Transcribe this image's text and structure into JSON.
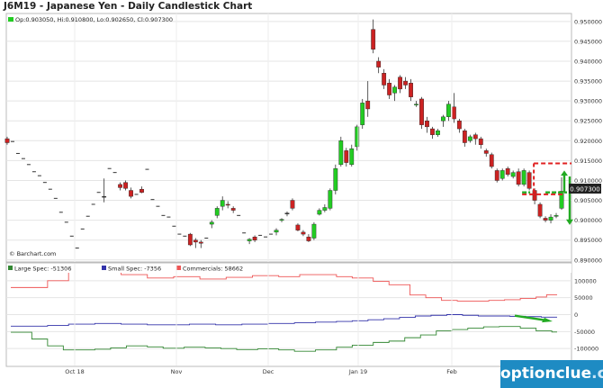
{
  "title": "J6M19 - Japanese Yen - Daily Candlestick Chart",
  "ohlc_legend": "Op:0.903050, Hi:0.910800, Lo:0.902650, Cl:0.907300",
  "credit": "© Barchart.com",
  "last_price_label": "0.907300",
  "brand": {
    "name": "optionclue",
    "suffix": ".com"
  },
  "colors": {
    "up": "#22cc22",
    "down": "#cc2222",
    "flat": "#333333",
    "large_spec": "#338833",
    "small_spec": "#3333aa",
    "commercials": "#ee5555",
    "annotation": "#e02020",
    "arrow": "#22aa22",
    "brand_bg": "#1e8bc3"
  },
  "chart_data": [
    {
      "type": "candlestick",
      "title": "J6M19 - Japanese Yen - Daily Candlestick Chart",
      "x_ticks": [
        "Oct 18",
        "Nov",
        "Dec",
        "Jan 19",
        "Feb"
      ],
      "y_ticks": [
        "0.890000",
        "0.895000",
        "0.900000",
        "0.905000",
        "0.910000",
        "0.915000",
        "0.920000",
        "0.925000",
        "0.930000",
        "0.935000",
        "0.940000",
        "0.945000",
        "0.950000"
      ],
      "ylim": [
        0.8895,
        0.952
      ],
      "grid": true,
      "candles": [
        {
          "o": 0.9205,
          "h": 0.921,
          "l": 0.919,
          "c": 0.9195
        },
        {
          "o": 0.9198,
          "h": 0.9198,
          "l": 0.9198,
          "c": 0.9198
        },
        {
          "o": 0.9168,
          "h": 0.9168,
          "l": 0.9168,
          "c": 0.9168
        },
        {
          "o": 0.9155,
          "h": 0.9155,
          "l": 0.9155,
          "c": 0.9155
        },
        {
          "o": 0.914,
          "h": 0.914,
          "l": 0.914,
          "c": 0.914
        },
        {
          "o": 0.9122,
          "h": 0.9122,
          "l": 0.9122,
          "c": 0.9122
        },
        {
          "o": 0.9112,
          "h": 0.9112,
          "l": 0.9112,
          "c": 0.9112
        },
        {
          "o": 0.9095,
          "h": 0.9095,
          "l": 0.9095,
          "c": 0.9095
        },
        {
          "o": 0.9078,
          "h": 0.9078,
          "l": 0.9078,
          "c": 0.9078
        },
        {
          "o": 0.9055,
          "h": 0.9055,
          "l": 0.9055,
          "c": 0.9055
        },
        {
          "o": 0.902,
          "h": 0.902,
          "l": 0.902,
          "c": 0.902
        },
        {
          "o": 0.8995,
          "h": 0.8995,
          "l": 0.8995,
          "c": 0.8995
        },
        {
          "o": 0.896,
          "h": 0.896,
          "l": 0.896,
          "c": 0.896
        },
        {
          "o": 0.893,
          "h": 0.893,
          "l": 0.893,
          "c": 0.893
        },
        {
          "o": 0.8978,
          "h": 0.8978,
          "l": 0.8978,
          "c": 0.8978
        },
        {
          "o": 0.901,
          "h": 0.901,
          "l": 0.901,
          "c": 0.901
        },
        {
          "o": 0.904,
          "h": 0.904,
          "l": 0.904,
          "c": 0.904
        },
        {
          "o": 0.907,
          "h": 0.907,
          "l": 0.907,
          "c": 0.907
        },
        {
          "o": 0.906,
          "h": 0.9105,
          "l": 0.9045,
          "c": 0.906
        },
        {
          "o": 0.913,
          "h": 0.913,
          "l": 0.913,
          "c": 0.913
        },
        {
          "o": 0.912,
          "h": 0.912,
          "l": 0.912,
          "c": 0.912
        },
        {
          "o": 0.909,
          "h": 0.9095,
          "l": 0.9075,
          "c": 0.9082
        },
        {
          "o": 0.9095,
          "h": 0.91,
          "l": 0.9075,
          "c": 0.908
        },
        {
          "o": 0.9075,
          "h": 0.9082,
          "l": 0.9055,
          "c": 0.906
        },
        {
          "o": 0.9065,
          "h": 0.9065,
          "l": 0.9065,
          "c": 0.9065
        },
        {
          "o": 0.9078,
          "h": 0.9085,
          "l": 0.9068,
          "c": 0.907
        },
        {
          "o": 0.9128,
          "h": 0.9128,
          "l": 0.9128,
          "c": 0.9128
        },
        {
          "o": 0.9052,
          "h": 0.9052,
          "l": 0.9052,
          "c": 0.9052
        },
        {
          "o": 0.9035,
          "h": 0.9035,
          "l": 0.9035,
          "c": 0.9035
        },
        {
          "o": 0.9012,
          "h": 0.9012,
          "l": 0.9012,
          "c": 0.9012
        },
        {
          "o": 0.9008,
          "h": 0.9008,
          "l": 0.9008,
          "c": 0.9008
        },
        {
          "o": 0.8985,
          "h": 0.8985,
          "l": 0.8985,
          "c": 0.8985
        },
        {
          "o": 0.8965,
          "h": 0.8965,
          "l": 0.8965,
          "c": 0.8965
        },
        {
          "o": 0.896,
          "h": 0.896,
          "l": 0.896,
          "c": 0.896
        },
        {
          "o": 0.8965,
          "h": 0.8968,
          "l": 0.8935,
          "c": 0.8938
        },
        {
          "o": 0.895,
          "h": 0.8955,
          "l": 0.893,
          "c": 0.8945
        },
        {
          "o": 0.8945,
          "h": 0.895,
          "l": 0.893,
          "c": 0.8942
        },
        {
          "o": 0.8955,
          "h": 0.8955,
          "l": 0.8955,
          "c": 0.8955
        },
        {
          "o": 0.899,
          "h": 0.9,
          "l": 0.898,
          "c": 0.8995
        },
        {
          "o": 0.9012,
          "h": 0.9035,
          "l": 0.9005,
          "c": 0.903
        },
        {
          "o": 0.9035,
          "h": 0.906,
          "l": 0.9025,
          "c": 0.905
        },
        {
          "o": 0.904,
          "h": 0.9048,
          "l": 0.903,
          "c": 0.9038
        },
        {
          "o": 0.903,
          "h": 0.9035,
          "l": 0.9018,
          "c": 0.9025
        },
        {
          "o": 0.9012,
          "h": 0.9012,
          "l": 0.9012,
          "c": 0.9012
        },
        {
          "o": 0.8968,
          "h": 0.8968,
          "l": 0.8968,
          "c": 0.8968
        },
        {
          "o": 0.8948,
          "h": 0.8955,
          "l": 0.894,
          "c": 0.8952
        },
        {
          "o": 0.8958,
          "h": 0.8962,
          "l": 0.8945,
          "c": 0.895
        },
        {
          "o": 0.8962,
          "h": 0.8962,
          "l": 0.8962,
          "c": 0.8962
        },
        {
          "o": 0.8958,
          "h": 0.8958,
          "l": 0.8958,
          "c": 0.8958
        },
        {
          "o": 0.8965,
          "h": 0.8965,
          "l": 0.8965,
          "c": 0.8965
        },
        {
          "o": 0.897,
          "h": 0.898,
          "l": 0.8962,
          "c": 0.8975
        },
        {
          "o": 0.9,
          "h": 0.9005,
          "l": 0.8995,
          "c": 0.9002
        },
        {
          "o": 0.9018,
          "h": 0.9022,
          "l": 0.901,
          "c": 0.9018
        },
        {
          "o": 0.905,
          "h": 0.9055,
          "l": 0.9025,
          "c": 0.903
        },
        {
          "o": 0.8988,
          "h": 0.8992,
          "l": 0.8972,
          "c": 0.8975
        },
        {
          "o": 0.897,
          "h": 0.8975,
          "l": 0.896,
          "c": 0.8965
        },
        {
          "o": 0.8958,
          "h": 0.8965,
          "l": 0.8945,
          "c": 0.8948
        },
        {
          "o": 0.8955,
          "h": 0.8995,
          "l": 0.895,
          "c": 0.899
        },
        {
          "o": 0.9015,
          "h": 0.903,
          "l": 0.9012,
          "c": 0.9025
        },
        {
          "o": 0.9025,
          "h": 0.904,
          "l": 0.902,
          "c": 0.9032
        },
        {
          "o": 0.903,
          "h": 0.908,
          "l": 0.9025,
          "c": 0.9075
        },
        {
          "o": 0.9075,
          "h": 0.914,
          "l": 0.9065,
          "c": 0.913
        },
        {
          "o": 0.914,
          "h": 0.921,
          "l": 0.9135,
          "c": 0.92
        },
        {
          "o": 0.9175,
          "h": 0.9182,
          "l": 0.9135,
          "c": 0.9145
        },
        {
          "o": 0.914,
          "h": 0.919,
          "l": 0.9135,
          "c": 0.918
        },
        {
          "o": 0.9185,
          "h": 0.924,
          "l": 0.9175,
          "c": 0.9235
        },
        {
          "o": 0.924,
          "h": 0.9305,
          "l": 0.923,
          "c": 0.9295
        },
        {
          "o": 0.93,
          "h": 0.935,
          "l": 0.926,
          "c": 0.928
        },
        {
          "o": 0.948,
          "h": 0.9505,
          "l": 0.942,
          "c": 0.943
        },
        {
          "o": 0.94,
          "h": 0.941,
          "l": 0.937,
          "c": 0.9385
        },
        {
          "o": 0.937,
          "h": 0.938,
          "l": 0.933,
          "c": 0.934
        },
        {
          "o": 0.9345,
          "h": 0.9355,
          "l": 0.9305,
          "c": 0.9315
        },
        {
          "o": 0.932,
          "h": 0.934,
          "l": 0.93,
          "c": 0.9335
        },
        {
          "o": 0.936,
          "h": 0.9365,
          "l": 0.932,
          "c": 0.933
        },
        {
          "o": 0.935,
          "h": 0.936,
          "l": 0.933,
          "c": 0.934
        },
        {
          "o": 0.9345,
          "h": 0.9355,
          "l": 0.93,
          "c": 0.931
        },
        {
          "o": 0.929,
          "h": 0.93,
          "l": 0.9285,
          "c": 0.9292
        },
        {
          "o": 0.9305,
          "h": 0.931,
          "l": 0.923,
          "c": 0.924
        },
        {
          "o": 0.925,
          "h": 0.926,
          "l": 0.922,
          "c": 0.9235
        },
        {
          "o": 0.923,
          "h": 0.9235,
          "l": 0.9205,
          "c": 0.9215
        },
        {
          "o": 0.9215,
          "h": 0.923,
          "l": 0.921,
          "c": 0.9225
        },
        {
          "o": 0.925,
          "h": 0.9265,
          "l": 0.9235,
          "c": 0.926
        },
        {
          "o": 0.926,
          "h": 0.93,
          "l": 0.925,
          "c": 0.9292
        },
        {
          "o": 0.9285,
          "h": 0.932,
          "l": 0.9245,
          "c": 0.9255
        },
        {
          "o": 0.925,
          "h": 0.9255,
          "l": 0.922,
          "c": 0.923
        },
        {
          "o": 0.9225,
          "h": 0.923,
          "l": 0.9185,
          "c": 0.9195
        },
        {
          "o": 0.92,
          "h": 0.9215,
          "l": 0.9195,
          "c": 0.921
        },
        {
          "o": 0.9215,
          "h": 0.922,
          "l": 0.919,
          "c": 0.9205
        },
        {
          "o": 0.9205,
          "h": 0.921,
          "l": 0.918,
          "c": 0.919
        },
        {
          "o": 0.9175,
          "h": 0.918,
          "l": 0.916,
          "c": 0.9168
        },
        {
          "o": 0.9165,
          "h": 0.917,
          "l": 0.913,
          "c": 0.9135
        },
        {
          "o": 0.9125,
          "h": 0.913,
          "l": 0.9095,
          "c": 0.91
        },
        {
          "o": 0.9105,
          "h": 0.913,
          "l": 0.91,
          "c": 0.9125
        },
        {
          "o": 0.913,
          "h": 0.9135,
          "l": 0.911,
          "c": 0.9115
        },
        {
          "o": 0.911,
          "h": 0.9125,
          "l": 0.9105,
          "c": 0.912
        },
        {
          "o": 0.9122,
          "h": 0.913,
          "l": 0.9085,
          "c": 0.909
        },
        {
          "o": 0.909,
          "h": 0.913,
          "l": 0.9085,
          "c": 0.9125
        },
        {
          "o": 0.912,
          "h": 0.9125,
          "l": 0.9075,
          "c": 0.908
        },
        {
          "o": 0.9075,
          "h": 0.908,
          "l": 0.904,
          "c": 0.905
        },
        {
          "o": 0.904,
          "h": 0.9045,
          "l": 0.9005,
          "c": 0.901
        },
        {
          "o": 0.9005,
          "h": 0.901,
          "l": 0.8995,
          "c": 0.9
        },
        {
          "o": 0.9,
          "h": 0.9015,
          "l": 0.8992,
          "c": 0.9008
        },
        {
          "o": 0.901,
          "h": 0.9018,
          "l": 0.9005,
          "c": 0.9012
        },
        {
          "o": 0.903,
          "h": 0.9108,
          "l": 0.9026,
          "c": 0.9073
        }
      ]
    },
    {
      "type": "line",
      "title": "",
      "y_ticks": [
        "-100000",
        "-50000",
        "0",
        "50000",
        "100000"
      ],
      "ylim": [
        -150000,
        150000
      ],
      "grid": true,
      "series": [
        {
          "name": "Large Spec: -51306",
          "values": [
            -52000,
            -52000,
            -52000,
            -52000,
            -72000,
            -72000,
            -72000,
            -92000,
            -92000,
            -92000,
            -104000,
            -104000,
            -104000,
            -104000,
            -104000,
            -104000,
            -102000,
            -102000,
            -102000,
            -98000,
            -98000,
            -98000,
            -92000,
            -92000,
            -92000,
            -92000,
            -95000,
            -95000,
            -95000,
            -99000,
            -99000,
            -99000,
            -99000,
            -96000,
            -96000,
            -96000,
            -96000,
            -98000,
            -98000,
            -98000,
            -100000,
            -100000,
            -100000,
            -103000,
            -103000,
            -103000,
            -103000,
            -101000,
            -101000,
            -101000,
            -101000,
            -104000,
            -104000,
            -104000,
            -108000,
            -108000,
            -108000,
            -108000,
            -104000,
            -104000,
            -104000,
            -104000,
            -96000,
            -96000,
            -96000,
            -90000,
            -90000,
            -90000,
            -90000,
            -82000,
            -82000,
            -82000,
            -78000,
            -78000,
            -78000,
            -68000,
            -68000,
            -68000,
            -60000,
            -60000,
            -60000,
            -48000,
            -48000,
            -48000,
            -44000,
            -44000,
            -44000,
            -40000,
            -40000,
            -40000,
            -36000,
            -36000,
            -36000,
            -35000,
            -35000,
            -35000,
            -35000,
            -40000,
            -40000,
            -40000,
            -48000,
            -48000,
            -48000,
            -51306,
            -51306
          ]
        },
        {
          "name": "Small Spec: -7356",
          "values": [
            -34000,
            -34000,
            -34000,
            -34000,
            -34000,
            -34000,
            -34000,
            -32000,
            -32000,
            -32000,
            -32000,
            -28000,
            -28000,
            -28000,
            -28000,
            -28000,
            -26000,
            -26000,
            -26000,
            -26000,
            -26000,
            -28000,
            -28000,
            -28000,
            -28000,
            -28000,
            -30000,
            -30000,
            -30000,
            -30000,
            -30000,
            -30000,
            -30000,
            -30000,
            -28000,
            -28000,
            -28000,
            -28000,
            -28000,
            -30000,
            -30000,
            -30000,
            -30000,
            -30000,
            -28000,
            -28000,
            -28000,
            -28000,
            -28000,
            -26000,
            -26000,
            -26000,
            -26000,
            -26000,
            -24000,
            -24000,
            -24000,
            -24000,
            -22000,
            -22000,
            -22000,
            -22000,
            -20000,
            -20000,
            -20000,
            -18000,
            -18000,
            -18000,
            -15000,
            -15000,
            -15000,
            -12000,
            -12000,
            -12000,
            -8000,
            -8000,
            -8000,
            -4000,
            -4000,
            -4000,
            -2000,
            -2000,
            -2000,
            0,
            0,
            0,
            -2000,
            -2000,
            -2000,
            -4000,
            -4000,
            -4000,
            -4000,
            -4000,
            -4000,
            -5000,
            -5000,
            -5000,
            -6000,
            -6000,
            -6000,
            -7356,
            -7356,
            -7356,
            -7356
          ]
        },
        {
          "name": "Commercials: 58662",
          "values": [
            80000,
            80000,
            80000,
            80000,
            80000,
            80000,
            80000,
            100000,
            100000,
            100000,
            100000,
            125000,
            125000,
            125000,
            125000,
            125000,
            130000,
            130000,
            130000,
            130000,
            130000,
            118000,
            118000,
            118000,
            118000,
            118000,
            108000,
            108000,
            108000,
            108000,
            108000,
            112000,
            112000,
            112000,
            112000,
            112000,
            105000,
            105000,
            105000,
            105000,
            105000,
            110000,
            110000,
            110000,
            110000,
            110000,
            115000,
            115000,
            115000,
            115000,
            115000,
            112000,
            112000,
            112000,
            112000,
            118000,
            118000,
            118000,
            118000,
            118000,
            118000,
            118000,
            112000,
            112000,
            112000,
            108000,
            108000,
            108000,
            108000,
            98000,
            98000,
            98000,
            88000,
            88000,
            88000,
            88000,
            58000,
            58000,
            58000,
            50000,
            50000,
            50000,
            42000,
            42000,
            42000,
            40000,
            40000,
            40000,
            40000,
            40000,
            40000,
            42000,
            42000,
            42000,
            44000,
            44000,
            44000,
            48000,
            48000,
            48000,
            52000,
            52000,
            58662,
            58662,
            58662
          ]
        }
      ]
    }
  ]
}
